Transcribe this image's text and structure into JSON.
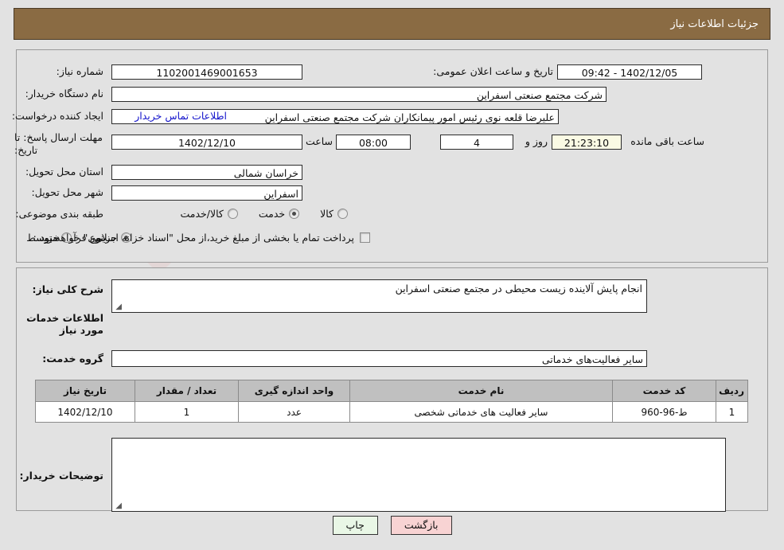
{
  "header": {
    "title": "جزئیات اطلاعات نیاز"
  },
  "watermark": {
    "text": "AriaTender.net"
  },
  "top_panel": {
    "need_number_label": "شماره نیاز:",
    "need_number_value": "1102001469001653",
    "announce_label": "تاریخ و ساعت اعلان عمومی:",
    "announce_value": "1402/12/05 - 09:42",
    "buyer_org_label": "نام دستگاه خریدار:",
    "buyer_org_value": "شرکت مجتمع صنعتی اسفراین",
    "creator_label": "ایجاد کننده درخواست:",
    "creator_value": "علیرضا قلعه نوی رئیس امور پیمانکاران شرکت مجتمع صنعتی اسفراین",
    "contact_link": "اطلاعات تماس خریدار",
    "deadline_label": "مهلت ارسال پاسخ: تا تاریخ:",
    "deadline_date": "1402/12/10",
    "hour_label": "ساعت",
    "deadline_time": "08:00",
    "days_value": "4",
    "days_unit": "روز و",
    "countdown_value": "21:23:10",
    "countdown_suffix": "ساعت باقی مانده",
    "province_label": "استان محل تحویل:",
    "province_value": "خراسان شمالی",
    "city_label": "شهر محل تحویل:",
    "city_value": "اسفراین",
    "category_label": "طبقه بندی موضوعی:",
    "category_options": [
      {
        "label": "کالا",
        "selected": false
      },
      {
        "label": "خدمت",
        "selected": true
      },
      {
        "label": "کالا/خدمت",
        "selected": false
      }
    ],
    "process_label": "نوع فرآیند خرید :",
    "process_options": [
      {
        "label": "جزیی",
        "selected": true
      },
      {
        "label": "متوسط",
        "selected": false
      }
    ],
    "treasury_checkbox_label": "پرداخت تمام یا بخشی از مبلغ خرید،از محل \"اسناد خزانه اسلامی\" خواهد بود.",
    "treasury_checked": false
  },
  "mid_panel": {
    "general_desc_label": "شرح کلی نیاز:",
    "general_desc_value": "انجام پایش آلاینده زیست محیطی در مجتمع صنعتی اسفراین",
    "services_section_title": "اطلاعات خدمات مورد نیاز",
    "service_group_label": "گروه خدمت:",
    "service_group_value": "سایر فعالیت‌های خدماتی",
    "table": {
      "headers": [
        "ردیف",
        "کد خدمت",
        "نام خدمت",
        "واحد اندازه گیری",
        "تعداد / مقدار",
        "تاریخ نیاز"
      ],
      "rows": [
        [
          "1",
          "ط-96-960",
          "سایر فعالیت های خدماتی شخصی",
          "عدد",
          "1",
          "1402/12/10"
        ]
      ]
    },
    "buyer_notes_label": "توضیحات خریدار:",
    "buyer_notes_value": ""
  },
  "footer": {
    "back_button": "بازگشت",
    "print_button": "چاپ"
  },
  "colors": {
    "header_bg": "#8a6b43",
    "page_bg": "#e2e2e2",
    "link": "#1414cc",
    "countdown_bg": "#fafae4",
    "back_btn_bg": "#f8d3d3",
    "print_btn_bg": "#e9f7e6",
    "table_header_bg": "#c0c0c0"
  }
}
